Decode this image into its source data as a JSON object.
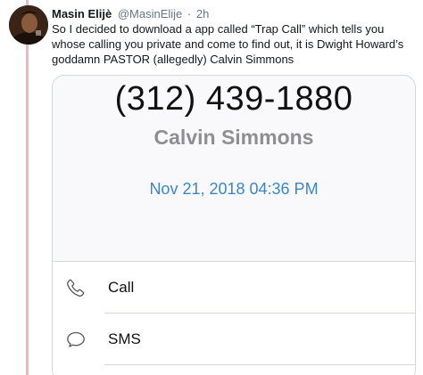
{
  "tweet": {
    "author_name": "Masin Elijè",
    "handle": "@MasinElije",
    "separator": "·",
    "time": "2h",
    "text": "So I decided to download a app called “Trap Call” which tells you whose calling you private and come to find out, it is Dwight Howard’s goddamn PASTOR (allegedly) Calvin Simmons"
  },
  "screenshot": {
    "phone_number": "(312) 439-1880",
    "contact_name": "Calvin Simmons",
    "call_date": "Nov 21, 2018 04:36 PM",
    "actions": [
      {
        "label": "Call",
        "icon": "phone-icon"
      },
      {
        "label": "SMS",
        "icon": "speech-bubble-icon"
      }
    ]
  },
  "colors": {
    "thread_line": "#e2bcc2",
    "date_blue": "#3d86c6",
    "name_gray": "#8e8e93",
    "handle_gray": "#657786"
  }
}
